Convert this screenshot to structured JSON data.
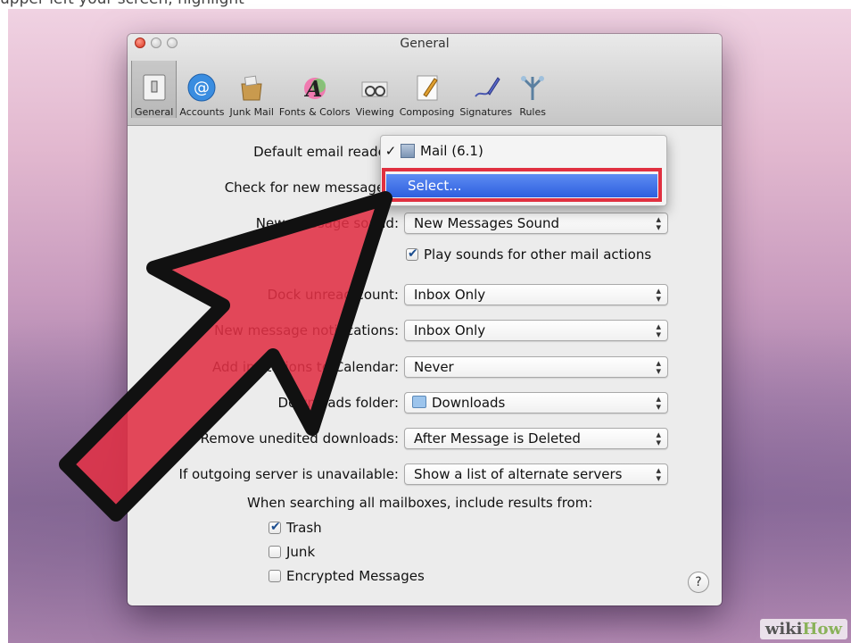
{
  "caption": "upper left your screen, highlight",
  "window": {
    "title": "General"
  },
  "toolbar": [
    {
      "label": "General",
      "icon": "general-switch-icon"
    },
    {
      "label": "Accounts",
      "icon": "at-sign-icon"
    },
    {
      "label": "Junk Mail",
      "icon": "junk-mail-bag-icon"
    },
    {
      "label": "Fonts & Colors",
      "icon": "fonts-colors-icon"
    },
    {
      "label": "Viewing",
      "icon": "viewing-glasses-icon"
    },
    {
      "label": "Composing",
      "icon": "composing-pencil-icon"
    },
    {
      "label": "Signatures",
      "icon": "signature-pen-icon"
    },
    {
      "label": "Rules",
      "icon": "rules-icon"
    }
  ],
  "settings": [
    {
      "label": "Default email reader",
      "value": ""
    },
    {
      "label": "Check for new messages",
      "value": ""
    },
    {
      "label": "New message sound:",
      "value": "New Messages Sound"
    },
    {
      "label": "Dock unread count:",
      "value": "Inbox Only"
    },
    {
      "label": "New message notifications:",
      "value": "Inbox Only"
    },
    {
      "label": "Add invitations to Calendar:",
      "value": "Never"
    },
    {
      "label": "Downloads folder:",
      "value": "Downloads"
    },
    {
      "label": "Remove unedited downloads:",
      "value": "After Message is Deleted"
    },
    {
      "label": "If outgoing server is unavailable:",
      "value": "Show a list of alternate servers"
    }
  ],
  "play_sounds": {
    "label": "Play sounds for other mail actions",
    "checked": true
  },
  "dropdown_menu": {
    "checkmark": "✓",
    "current": "Mail (6.1)",
    "highlighted": "Select..."
  },
  "search": {
    "heading": "When searching all mailboxes, include results from:",
    "options": [
      {
        "label": "Trash",
        "checked": true
      },
      {
        "label": "Junk",
        "checked": false
      },
      {
        "label": "Encrypted Messages",
        "checked": false
      }
    ]
  },
  "help": {
    "label": "?"
  },
  "watermark": {
    "wiki": "wiki",
    "how": "How"
  },
  "colors": {
    "annotation_red": "#e03040",
    "selection_blue": "#2e5fdf"
  }
}
